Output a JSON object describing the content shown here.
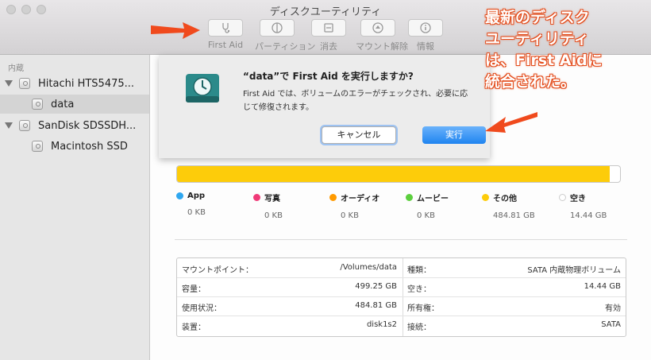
{
  "window": {
    "title": "ディスクユーティリティ"
  },
  "toolbar": [
    {
      "label": "First Aid",
      "icon": "stethoscope-icon"
    },
    {
      "label": "パーティション",
      "icon": "partition-icon"
    },
    {
      "label": "消去",
      "icon": "erase-icon"
    },
    {
      "label": "マウント解除",
      "icon": "unmount-icon"
    },
    {
      "label": "情報",
      "icon": "info-icon"
    }
  ],
  "sidebar": {
    "section": "内蔵",
    "items": [
      {
        "label": "Hitachi HTS5475...",
        "level": 0
      },
      {
        "label": "data",
        "level": 1,
        "selected": true
      },
      {
        "label": "SanDisk SDSSDH...",
        "level": 0
      },
      {
        "label": "Macintosh SSD",
        "level": 1
      }
    ]
  },
  "dialog": {
    "title": "“data”で First Aid を実行しますか?",
    "body": "First Aid では、ボリュームのエラーがチェックされ、必要に応じて修復されます。",
    "cancel": "キャンセル",
    "run": "実行"
  },
  "usage": {
    "fill_fraction": 0.977,
    "fill_color": "#fdcc0a",
    "legend": [
      {
        "label": "App",
        "value": "0 KB",
        "color": "#2fa7f0"
      },
      {
        "label": "写真",
        "value": "0 KB",
        "color": "#f03a78"
      },
      {
        "label": "オーディオ",
        "value": "0 KB",
        "color": "#ff9a00"
      },
      {
        "label": "ムービー",
        "value": "0 KB",
        "color": "#5ccf3e"
      },
      {
        "label": "その他",
        "value": "484.81 GB",
        "color": "#fdcc0a"
      },
      {
        "label": "空き",
        "value": "14.44 GB",
        "color": "#ffffff"
      }
    ]
  },
  "info": {
    "rows": [
      {
        "l_label": "マウントポイント：",
        "l_value": "/Volumes/data",
        "r_label": "種類：",
        "r_value": "SATA 内蔵物理ボリューム"
      },
      {
        "l_label": "容量：",
        "l_value": "499.25 GB",
        "r_label": "空き：",
        "r_value": "14.44 GB"
      },
      {
        "l_label": "使用状況：",
        "l_value": "484.81 GB",
        "r_label": "所有権：",
        "r_value": "有効"
      },
      {
        "l_label": "装置：",
        "l_value": "disk1s2",
        "r_label": "接続：",
        "r_value": "SATA"
      }
    ]
  },
  "annotation": {
    "lines": [
      "最新のディスク",
      "ユーティリティ",
      "は、First Aidに",
      "統合された。"
    ],
    "color": "#e34b1a"
  }
}
